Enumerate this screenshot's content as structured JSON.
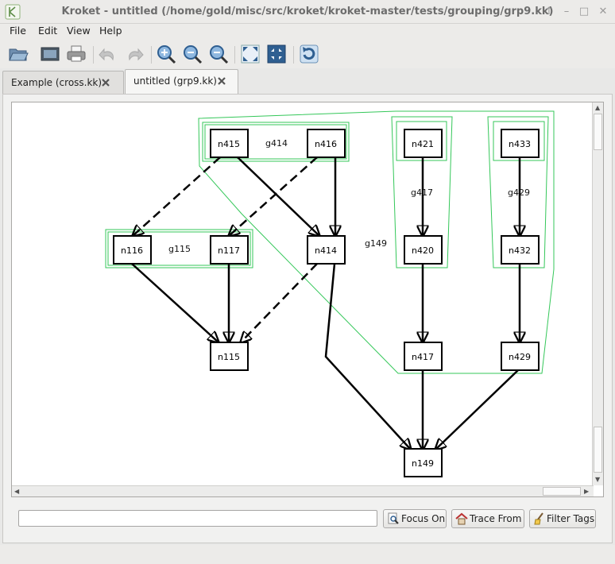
{
  "window": {
    "title": "Kroket - untitled (/home/gold/misc/src/kroket/kroket-master/tests/grouping/grp9.kk)"
  },
  "window_controls": [
    "↑",
    "–",
    "□",
    "✕"
  ],
  "menu": [
    "File",
    "Edit",
    "View",
    "Help"
  ],
  "toolbar": {
    "icons": [
      "open-folder-icon",
      "image-icon",
      "print-icon",
      "undo-icon",
      "redo-icon",
      "zoom-fit-icon",
      "zoom-in-icon",
      "zoom-out-icon",
      "fullscreen-icon",
      "fit-window-icon",
      "refresh-icon"
    ]
  },
  "tabs": [
    {
      "label": "Example (cross.kk)",
      "active": false
    },
    {
      "label": "untitled (grp9.kk)",
      "active": true
    }
  ],
  "graph": {
    "nodes": [
      "n415",
      "n416",
      "n421",
      "n433",
      "n116",
      "n117",
      "n414",
      "n420",
      "n432",
      "n115",
      "n417",
      "n429",
      "n149"
    ],
    "groups": [
      "g414",
      "g417",
      "g429",
      "g115",
      "g149"
    ],
    "edge_color": "#000000",
    "group_color": "#34c759"
  },
  "search": {
    "value": "",
    "placeholder": ""
  },
  "actions": {
    "focus_on": "Focus On",
    "trace_from": "Trace From",
    "filter_tags": "Filter Tags"
  }
}
